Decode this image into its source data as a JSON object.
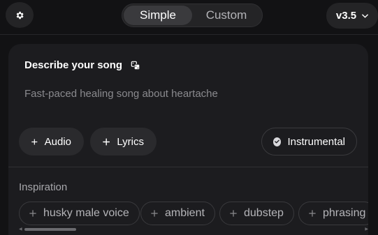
{
  "header": {
    "settings_icon": "gear-icon",
    "modes": [
      {
        "label": "Simple",
        "active": true
      },
      {
        "label": "Custom",
        "active": false
      }
    ],
    "version_label": "v3.5",
    "version_icon": "chevron-down-icon"
  },
  "card": {
    "title": "Describe your song",
    "title_icon": "dice-icon",
    "prompt_text": "Fast-paced healing song about heartache",
    "buttons": {
      "audio_label": "Audio",
      "lyrics_label": "Lyrics",
      "instrumental_label": "Instrumental"
    },
    "inspiration_label": "Inspiration",
    "tags": [
      "husky male voice",
      "ambient",
      "dubstep",
      "phrasing"
    ]
  },
  "colors": {
    "background": "#121214",
    "card": "#1c1c1f",
    "chip": "#2a2a2d",
    "muted_text": "#8a8a8e"
  }
}
